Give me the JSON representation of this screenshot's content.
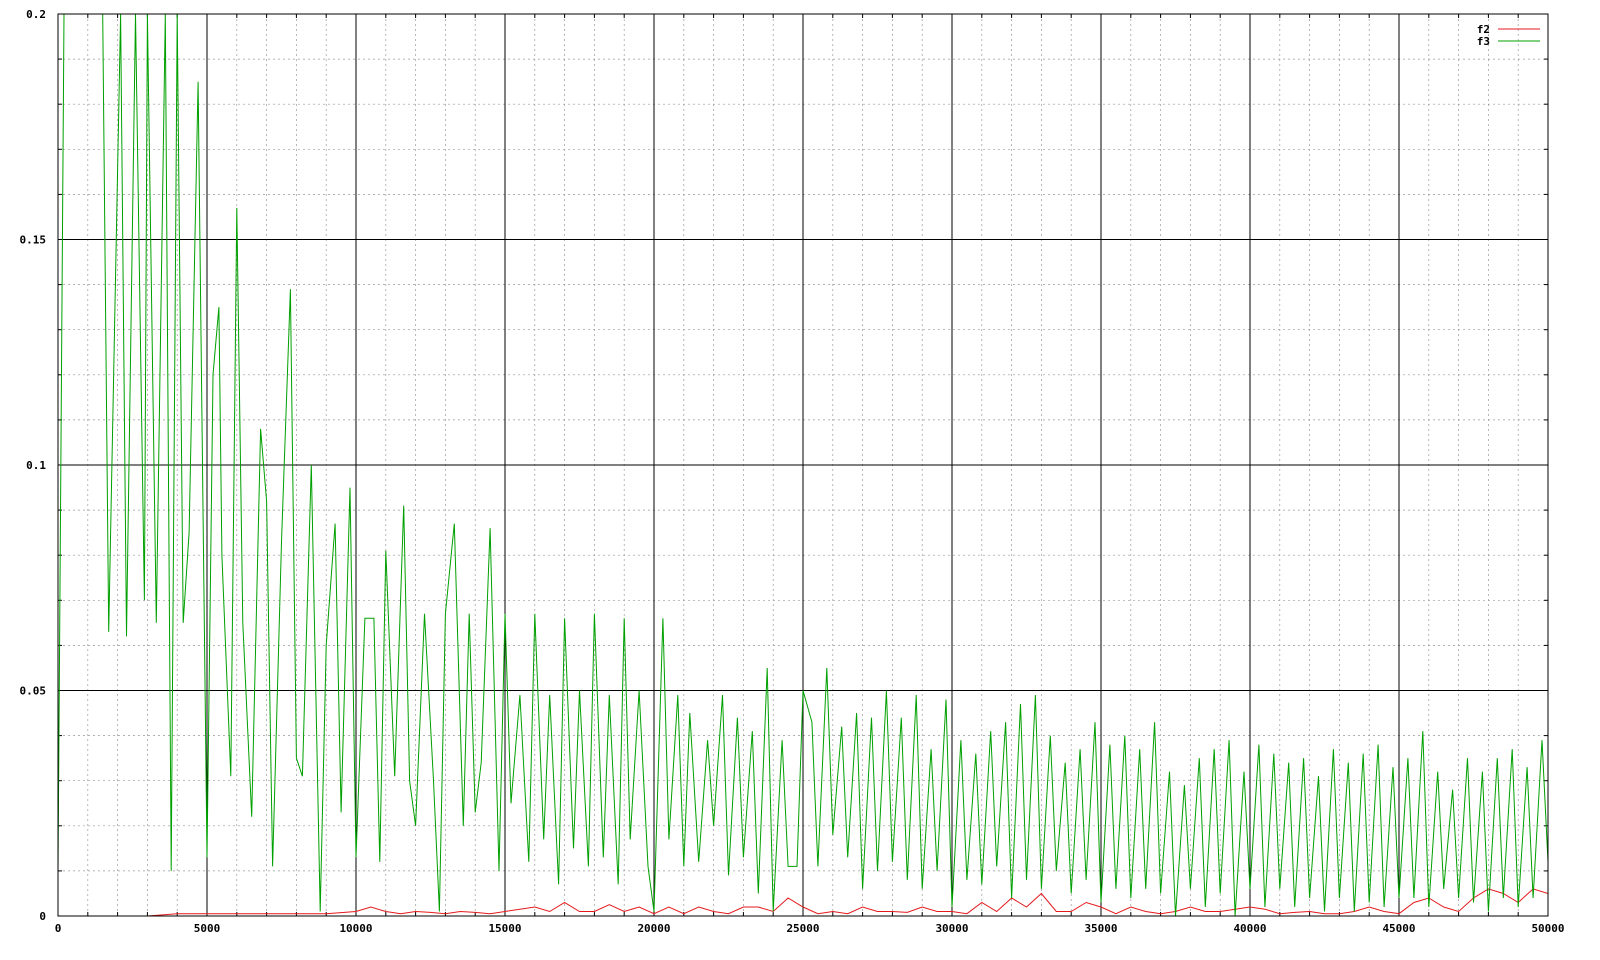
{
  "chart_data": {
    "type": "line",
    "title": "",
    "xlabel": "",
    "ylabel": "",
    "xlim": [
      0,
      50000
    ],
    "ylim": [
      0,
      0.2
    ],
    "x_major_ticks": [
      0,
      5000,
      10000,
      15000,
      20000,
      25000,
      30000,
      35000,
      40000,
      45000,
      50000
    ],
    "x_tick_labels": [
      "0",
      "5000",
      "10000",
      "15000",
      "20000",
      "25000",
      "30000",
      "35000",
      "40000",
      "45000",
      "50000"
    ],
    "y_major_ticks": [
      0,
      0.05,
      0.1,
      0.15,
      0.2
    ],
    "y_tick_labels": [
      "0",
      "0.05",
      "0.1",
      "0.15",
      "0.2"
    ],
    "x_minor_step": 1000,
    "y_minor_step": 0.01,
    "grid": true,
    "legend_position": "top-right",
    "series": [
      {
        "name": "f2",
        "color": "#e41a1c",
        "x": [
          0,
          1000,
          2000,
          3000,
          4000,
          5000,
          6000,
          7000,
          8000,
          9000,
          10000,
          10500,
          11000,
          11500,
          12000,
          12500,
          13000,
          13500,
          14000,
          14500,
          15000,
          15500,
          16000,
          16500,
          17000,
          17500,
          18000,
          18500,
          19000,
          19500,
          20000,
          20500,
          21000,
          21500,
          22000,
          22500,
          23000,
          23500,
          24000,
          24500,
          25000,
          25500,
          26000,
          26500,
          27000,
          27500,
          28000,
          28500,
          29000,
          29500,
          30000,
          30500,
          31000,
          31500,
          32000,
          32500,
          33000,
          33500,
          34000,
          34500,
          35000,
          35500,
          36000,
          36500,
          37000,
          37500,
          38000,
          38500,
          39000,
          39500,
          40000,
          40500,
          41000,
          41500,
          42000,
          42500,
          43000,
          43500,
          44000,
          44500,
          45000,
          45500,
          46000,
          46500,
          47000,
          47500,
          48000,
          48500,
          49000,
          49500,
          50000
        ],
        "y": [
          0,
          0,
          0,
          0,
          0.0005,
          0.0005,
          0.0005,
          0.0005,
          0.0005,
          0.0005,
          0.001,
          0.002,
          0.001,
          0.0005,
          0.001,
          0.0008,
          0.0005,
          0.001,
          0.0008,
          0.0005,
          0.001,
          0.0015,
          0.002,
          0.001,
          0.003,
          0.001,
          0.001,
          0.0025,
          0.001,
          0.002,
          0.0005,
          0.002,
          0.0005,
          0.002,
          0.001,
          0.0005,
          0.002,
          0.002,
          0.001,
          0.004,
          0.002,
          0.0005,
          0.001,
          0.0005,
          0.002,
          0.001,
          0.001,
          0.0008,
          0.002,
          0.001,
          0.001,
          0.0005,
          0.003,
          0.001,
          0.004,
          0.002,
          0.005,
          0.001,
          0.001,
          0.003,
          0.002,
          0.0005,
          0.002,
          0.001,
          0.0005,
          0.001,
          0.002,
          0.001,
          0.001,
          0.0015,
          0.002,
          0.0015,
          0.0005,
          0.0008,
          0.001,
          0.0005,
          0.0005,
          0.001,
          0.002,
          0.001,
          0.0005,
          0.003,
          0.004,
          0.002,
          0.001,
          0.004,
          0.006,
          0.005,
          0.003,
          0.006,
          0.005
        ]
      },
      {
        "name": "f3",
        "color": "#00a000",
        "x": [
          0,
          200,
          1500,
          1700,
          2100,
          2300,
          2600,
          2900,
          3000,
          3300,
          3600,
          3800,
          4000,
          4200,
          4400,
          4700,
          5000,
          5200,
          5400,
          5500,
          5800,
          6000,
          6200,
          6500,
          6800,
          7000,
          7200,
          7500,
          7800,
          8000,
          8200,
          8500,
          8800,
          9000,
          9300,
          9500,
          9800,
          10000,
          10300,
          10600,
          10800,
          11000,
          11300,
          11600,
          11800,
          12000,
          12300,
          12600,
          12800,
          13000,
          13300,
          13600,
          13800,
          14000,
          14200,
          14500,
          14800,
          15000,
          15200,
          15500,
          15800,
          16000,
          16300,
          16500,
          16800,
          17000,
          17300,
          17500,
          17800,
          18000,
          18300,
          18500,
          18800,
          19000,
          19200,
          19500,
          19800,
          20000,
          20300,
          20500,
          20800,
          21000,
          21200,
          21500,
          21800,
          22000,
          22300,
          22500,
          22800,
          23000,
          23300,
          23500,
          23800,
          24000,
          24300,
          24500,
          24800,
          25000,
          25300,
          25500,
          25800,
          26000,
          26300,
          26500,
          26800,
          27000,
          27300,
          27500,
          27800,
          28000,
          28300,
          28500,
          28800,
          29000,
          29300,
          29500,
          29800,
          30000,
          30300,
          30500,
          30800,
          31000,
          31300,
          31500,
          31800,
          32000,
          32300,
          32500,
          32800,
          33000,
          33300,
          33500,
          33800,
          34000,
          34300,
          34500,
          34800,
          35000,
          35300,
          35500,
          35800,
          36000,
          36300,
          36500,
          36800,
          37000,
          37300,
          37500,
          37800,
          38000,
          38300,
          38500,
          38800,
          39000,
          39300,
          39500,
          39800,
          40000,
          40300,
          40500,
          40800,
          41000,
          41300,
          41500,
          41800,
          42000,
          42300,
          42500,
          42800,
          43000,
          43300,
          43500,
          43800,
          44000,
          44300,
          44500,
          44800,
          45000,
          45300,
          45500,
          45800,
          46000,
          46300,
          46500,
          46800,
          47000,
          47300,
          47500,
          47800,
          48000,
          48300,
          48500,
          48800,
          49000,
          49300,
          49500,
          49800,
          50000
        ],
        "y": [
          0.01,
          0.2,
          0.2,
          0.063,
          0.2,
          0.062,
          0.2,
          0.07,
          0.2,
          0.065,
          0.2,
          0.01,
          0.2,
          0.065,
          0.085,
          0.185,
          0.013,
          0.12,
          0.135,
          0.08,
          0.031,
          0.157,
          0.065,
          0.022,
          0.108,
          0.092,
          0.011,
          0.083,
          0.139,
          0.035,
          0.031,
          0.1,
          0.001,
          0.06,
          0.087,
          0.023,
          0.095,
          0.013,
          0.066,
          0.066,
          0.012,
          0.081,
          0.031,
          0.091,
          0.03,
          0.02,
          0.067,
          0.03,
          0.001,
          0.067,
          0.087,
          0.02,
          0.067,
          0.023,
          0.034,
          0.086,
          0.01,
          0.067,
          0.025,
          0.049,
          0.012,
          0.067,
          0.017,
          0.049,
          0.007,
          0.066,
          0.015,
          0.05,
          0.011,
          0.067,
          0.013,
          0.049,
          0.007,
          0.066,
          0.017,
          0.05,
          0.011,
          0.001,
          0.066,
          0.017,
          0.049,
          0.011,
          0.045,
          0.012,
          0.039,
          0.02,
          0.049,
          0.009,
          0.044,
          0.013,
          0.041,
          0.005,
          0.055,
          0.001,
          0.039,
          0.011,
          0.011,
          0.05,
          0.043,
          0.011,
          0.055,
          0.018,
          0.042,
          0.013,
          0.045,
          0.006,
          0.044,
          0.01,
          0.05,
          0.012,
          0.044,
          0.008,
          0.049,
          0.006,
          0.037,
          0.01,
          0.048,
          0.002,
          0.039,
          0.008,
          0.036,
          0.007,
          0.041,
          0.011,
          0.043,
          0.004,
          0.047,
          0.008,
          0.049,
          0.006,
          0.04,
          0.01,
          0.034,
          0.005,
          0.037,
          0.008,
          0.043,
          0.003,
          0.038,
          0.006,
          0.04,
          0.004,
          0.037,
          0.006,
          0.043,
          0.005,
          0.032,
          0.0,
          0.029,
          0.006,
          0.035,
          0.002,
          0.037,
          0.005,
          0.039,
          0.0,
          0.032,
          0.006,
          0.038,
          0.002,
          0.036,
          0.006,
          0.034,
          0.002,
          0.035,
          0.004,
          0.031,
          0.001,
          0.037,
          0.004,
          0.034,
          0.001,
          0.036,
          0.003,
          0.038,
          0.002,
          0.033,
          0.004,
          0.035,
          0.004,
          0.041,
          0.002,
          0.032,
          0.006,
          0.028,
          0.004,
          0.035,
          0.003,
          0.032,
          0.001,
          0.035,
          0.004,
          0.037,
          0.002,
          0.033,
          0.004,
          0.039,
          0.012
        ]
      }
    ]
  }
}
